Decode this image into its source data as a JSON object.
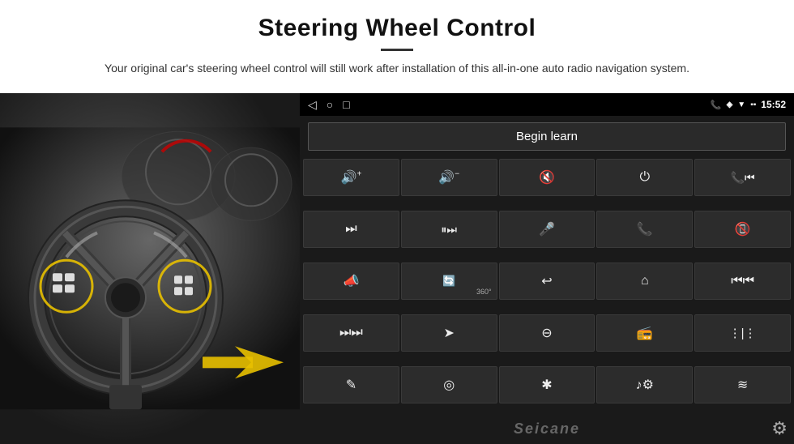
{
  "header": {
    "title": "Steering Wheel Control",
    "subtitle": "Your original car's steering wheel control will still work after installation of this all-in-one auto radio navigation system."
  },
  "status_bar": {
    "nav_back": "◁",
    "nav_home": "○",
    "nav_recent": "□",
    "signal_label": "▪▪",
    "time": "15:52",
    "phone_icon": "📞",
    "location_icon": "◈",
    "wifi_icon": "▼"
  },
  "begin_learn": {
    "label": "Begin learn"
  },
  "controls": [
    {
      "icon": "🔊+",
      "label": "vol_up_with_icon",
      "symbol": "vol+"
    },
    {
      "icon": "🔊-",
      "label": "vol_down",
      "symbol": "vol-"
    },
    {
      "icon": "🔇",
      "label": "mute",
      "symbol": "mute"
    },
    {
      "icon": "⏻",
      "label": "power",
      "symbol": "power"
    },
    {
      "icon": "📞⏮",
      "label": "call_prev",
      "symbol": "call_prev"
    },
    {
      "icon": "⏭",
      "label": "next_track",
      "symbol": "next"
    },
    {
      "icon": "⏸⏭",
      "label": "skip",
      "symbol": "skip"
    },
    {
      "icon": "🎤",
      "label": "mic",
      "symbol": "mic"
    },
    {
      "icon": "📞",
      "label": "phone",
      "symbol": "phone"
    },
    {
      "icon": "↩",
      "label": "hang_up",
      "symbol": "hangup"
    },
    {
      "icon": "📣",
      "label": "horn",
      "symbol": "horn"
    },
    {
      "icon": "⟳",
      "label": "360",
      "symbol": "360"
    },
    {
      "icon": "↩",
      "label": "back",
      "symbol": "back"
    },
    {
      "icon": "⌂",
      "label": "home",
      "symbol": "home"
    },
    {
      "icon": "⏮⏮",
      "label": "prev_track",
      "symbol": "prev"
    },
    {
      "icon": "⏭⏭",
      "label": "fast_forward",
      "symbol": "ff"
    },
    {
      "icon": "➤",
      "label": "navigation",
      "symbol": "nav"
    },
    {
      "icon": "⊖",
      "label": "eject",
      "symbol": "eject"
    },
    {
      "icon": "📻",
      "label": "radio",
      "symbol": "radio"
    },
    {
      "icon": "≡|",
      "label": "eq",
      "symbol": "eq"
    },
    {
      "icon": "✎",
      "label": "edit",
      "symbol": "edit"
    },
    {
      "icon": "◎",
      "label": "camera",
      "symbol": "camera"
    },
    {
      "icon": "✱",
      "label": "bluetooth",
      "symbol": "bt"
    },
    {
      "icon": "♪⚙",
      "label": "music_settings",
      "symbol": "music"
    },
    {
      "icon": "≋",
      "label": "equalizer",
      "symbol": "equalizer"
    }
  ],
  "watermark": "Seicane",
  "gear_symbol": "⚙"
}
